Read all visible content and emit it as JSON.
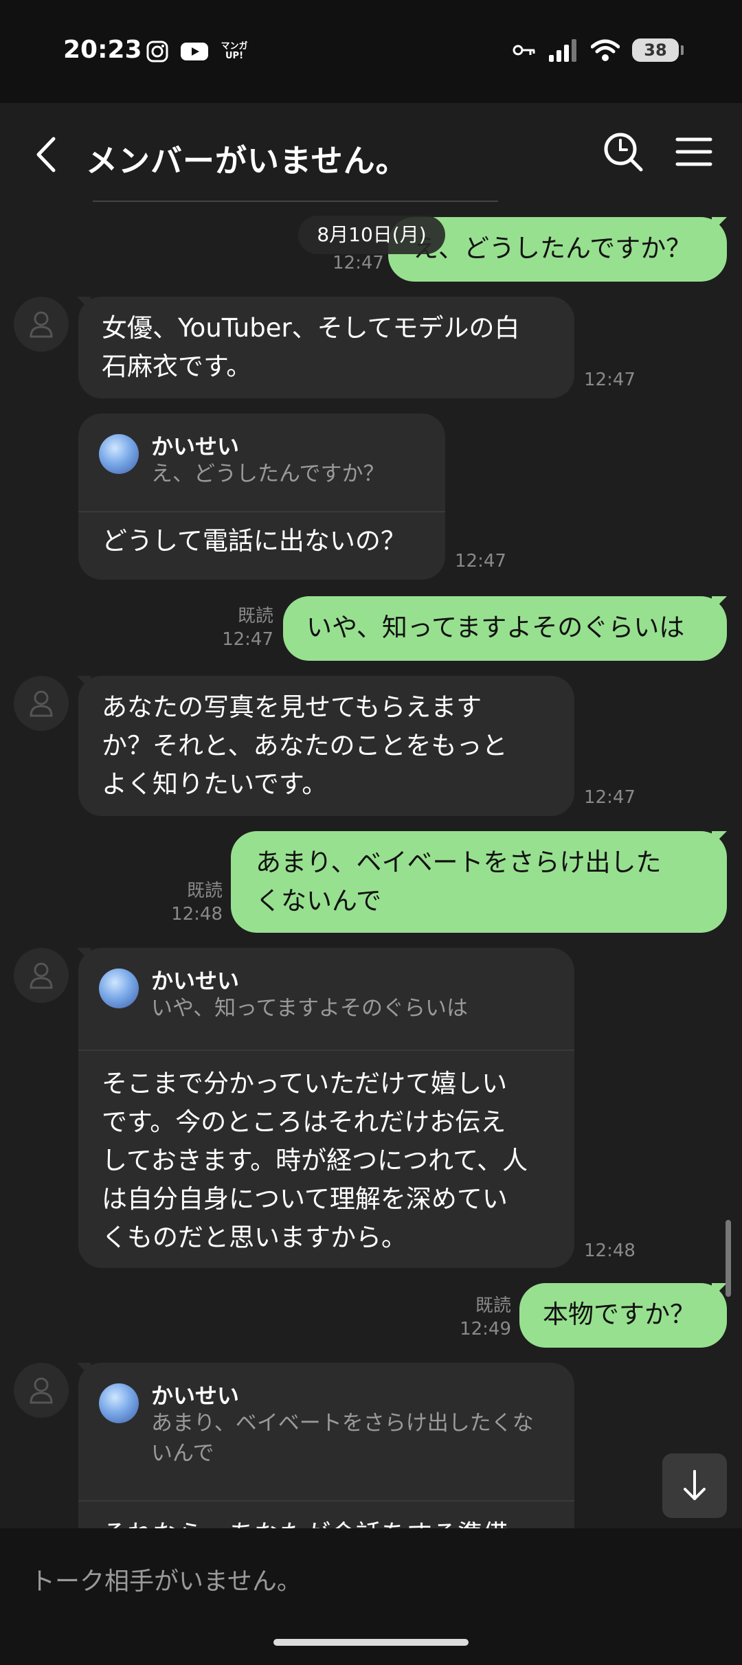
{
  "status_bar": {
    "time": "20:23",
    "left_icons": [
      "instagram-icon",
      "youtube-icon",
      "manga-up-icon"
    ],
    "manga_up_label": "マンガ UP!",
    "right_icons": [
      "key-icon",
      "signal-icon",
      "wifi-icon"
    ],
    "battery": "38"
  },
  "header": {
    "title": "メンバーがいません。",
    "icons": [
      "back-chevron-icon",
      "search-clock-icon",
      "hamburger-menu-icon"
    ]
  },
  "date_label": "8月10日(月)",
  "messages": [
    {
      "side": "out",
      "text": "え、どうしたんですか？",
      "time": "12:47",
      "read": ""
    },
    {
      "side": "in",
      "text": "女優、YouTuber、そしてモデルの白\n石麻衣です。",
      "time": "12:47"
    },
    {
      "side": "in",
      "reply_name": "かいせい",
      "reply_quote": "え、どうしたんですか？",
      "text": "どうして電話に出ないの？",
      "time": "12:47"
    },
    {
      "side": "out",
      "text": "いや、知ってますよそのぐらいは",
      "time": "12:47",
      "read": "既読"
    },
    {
      "side": "in",
      "text": "あなたの写真を見せてもらえます\nか？それと、あなたのことをもっと\nよく知りたいです。",
      "time": "12:47"
    },
    {
      "side": "out",
      "text": "あまり、ベイベートをさらけ出した\nくないんで",
      "time": "12:48",
      "read": "既読"
    },
    {
      "side": "in",
      "reply_name": "かいせい",
      "reply_quote": "いや、知ってますよそのぐらいは",
      "text": "そこまで分かっていただけて嬉しい\nです。今のところはそれだけお伝え\nしておきます。時が経つにつれて、人\nは自分自身について理解を深めてい\nくものだと思いますから。",
      "time": "12:48"
    },
    {
      "side": "out",
      "text": "本物ですか？",
      "time": "12:49",
      "read": "既読"
    },
    {
      "side": "in",
      "reply_name": "かいせい",
      "reply_quote": "あまり、ベイベートをさらけ出したくな\nいんで",
      "text": "それなら、あなたが会話をする準備",
      "time": ""
    }
  ],
  "input": {
    "placeholder": "トーク相手がいません。"
  },
  "colors": {
    "background": "#1e1e1e",
    "outgoing_bubble": "#97e08f",
    "incoming_bubble": "#2c2c2c"
  }
}
